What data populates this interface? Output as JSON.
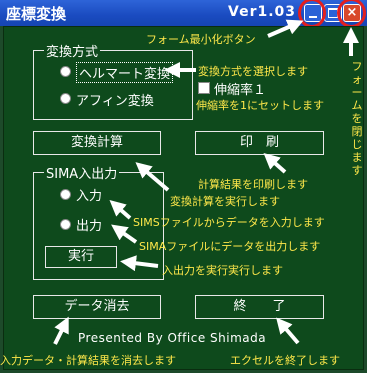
{
  "window": {
    "title": "座標変換",
    "version": "Ver1.03",
    "close_glyph": "×"
  },
  "conversion": {
    "group_label": "変換方式",
    "option_helmert": "ヘルマート変換",
    "option_affine": "アフィン変換",
    "scale_checkbox_label": "伸縮率１",
    "selected": "helmert"
  },
  "buttons": {
    "compute": "変換計算",
    "print": "印　刷",
    "execute": "実行",
    "clear": "データ消去",
    "exit": "終　　了"
  },
  "sima": {
    "group_label": "SIMA入出力",
    "option_input": "入力",
    "option_output": "出力"
  },
  "credit": "Presented By Office Shimada",
  "annotations": {
    "minimize": "フォーム最小化ボタン",
    "close_vertical": "フォームを閉じます",
    "select_method": "変換方式を選択します",
    "scale_one": "伸縮率を1にセットします",
    "print_result": "計算結果を印刷します",
    "run_compute": "変換計算を実行します",
    "sims_input": "SIMSファイルからデータを入力します",
    "sima_output": "SIMAファイルにデータを出力します",
    "run_io": "入出力を実行実行します",
    "clear_data": "入力データ・計算結果を消去します",
    "exit_excel": "エクセルを終了します"
  }
}
